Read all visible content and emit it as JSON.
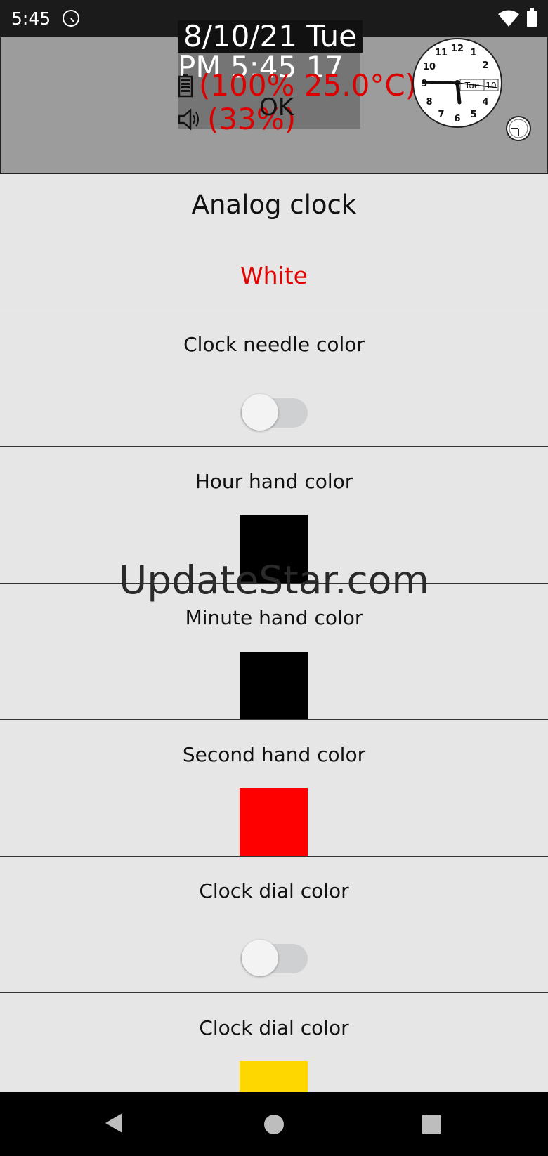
{
  "status_bar": {
    "time": "5:45"
  },
  "widget": {
    "date_line": "8/10/21 Tue",
    "time_line": "PM 5:45 17",
    "battery_text": "(100% 25.0°C)",
    "volume_text": "(33%)",
    "ok_text": "OK",
    "clock_date": "Tue",
    "clock_day": "10"
  },
  "section": {
    "title": "Analog clock",
    "selected_value": "White"
  },
  "settings": [
    {
      "label": "Clock needle color",
      "type": "toggle",
      "checked": false
    },
    {
      "label": "Hour hand color",
      "type": "swatch",
      "color": "#000000"
    },
    {
      "label": "Minute hand color",
      "type": "swatch",
      "color": "#000000"
    },
    {
      "label": "Second hand color",
      "type": "swatch",
      "color": "#ff0000"
    },
    {
      "label": "Clock dial color",
      "type": "toggle",
      "checked": false
    },
    {
      "label": "Clock dial color",
      "type": "swatch",
      "color": "#ffd700"
    }
  ],
  "watermark": "UpdateStar.com",
  "icons": {
    "status": [
      "clock-icon",
      "wifi-icon",
      "battery-icon"
    ],
    "nav": [
      "back-icon",
      "home-icon",
      "recents-icon"
    ]
  }
}
